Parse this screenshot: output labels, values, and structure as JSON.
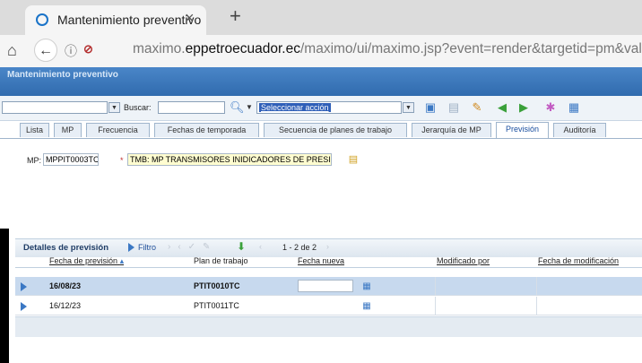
{
  "browser": {
    "tab_title": "Mantenimiento preventivo",
    "close_glyph": "×",
    "new_tab_glyph": "+",
    "home_glyph": "⌂",
    "back_glyph": "←",
    "info_glyph": "ⓘ",
    "insecure_glyph": "⊘",
    "url_prefix": "maximo.",
    "url_host": "eppetroecuador.ec",
    "url_path": "/maximo/ui/maximo.jsp?event=render&targetid=pm&value="
  },
  "app": {
    "title": "Mantenimiento preventivo",
    "search_label": "Buscar:",
    "search_value": "",
    "select_action": "Seleccionar acción"
  },
  "tabs": [
    {
      "label": "Lista"
    },
    {
      "label": "MP"
    },
    {
      "label": "Frecuencia"
    },
    {
      "label": "Fechas de temporada"
    },
    {
      "label": "Secuencia de planes de trabajo"
    },
    {
      "label": "Jerarquía de MP"
    },
    {
      "label": "Previsión"
    },
    {
      "label": "Auditoría"
    }
  ],
  "fields": {
    "mp_label": "MP:",
    "mp_value": "MPPIT0003TC",
    "desc_prefix": "*",
    "desc_value": "TMB: MP TRANSMISORES INIDICADORES DE PRESIO"
  },
  "table": {
    "title": "Detalles de previsión",
    "filter_label": "Filtro",
    "pagination": "1 - 2 de 2",
    "columns": [
      "Fecha de previsión",
      "Plan de trabajo",
      "Fecha nueva",
      "Modificado por",
      "Fecha de modificación"
    ],
    "rows": [
      {
        "fecha": "16/08/23",
        "plan": "PTIT0010TC",
        "nueva": "",
        "modificado": "",
        "fecha_mod": ""
      },
      {
        "fecha": "16/12/23",
        "plan": "PTIT0011TC",
        "nueva": "",
        "modificado": "",
        "fecha_mod": ""
      }
    ]
  },
  "colors": {
    "header_blue": "#2f6aad",
    "selected_row": "#c7d9ee",
    "accent_green": "#3aa03a"
  }
}
